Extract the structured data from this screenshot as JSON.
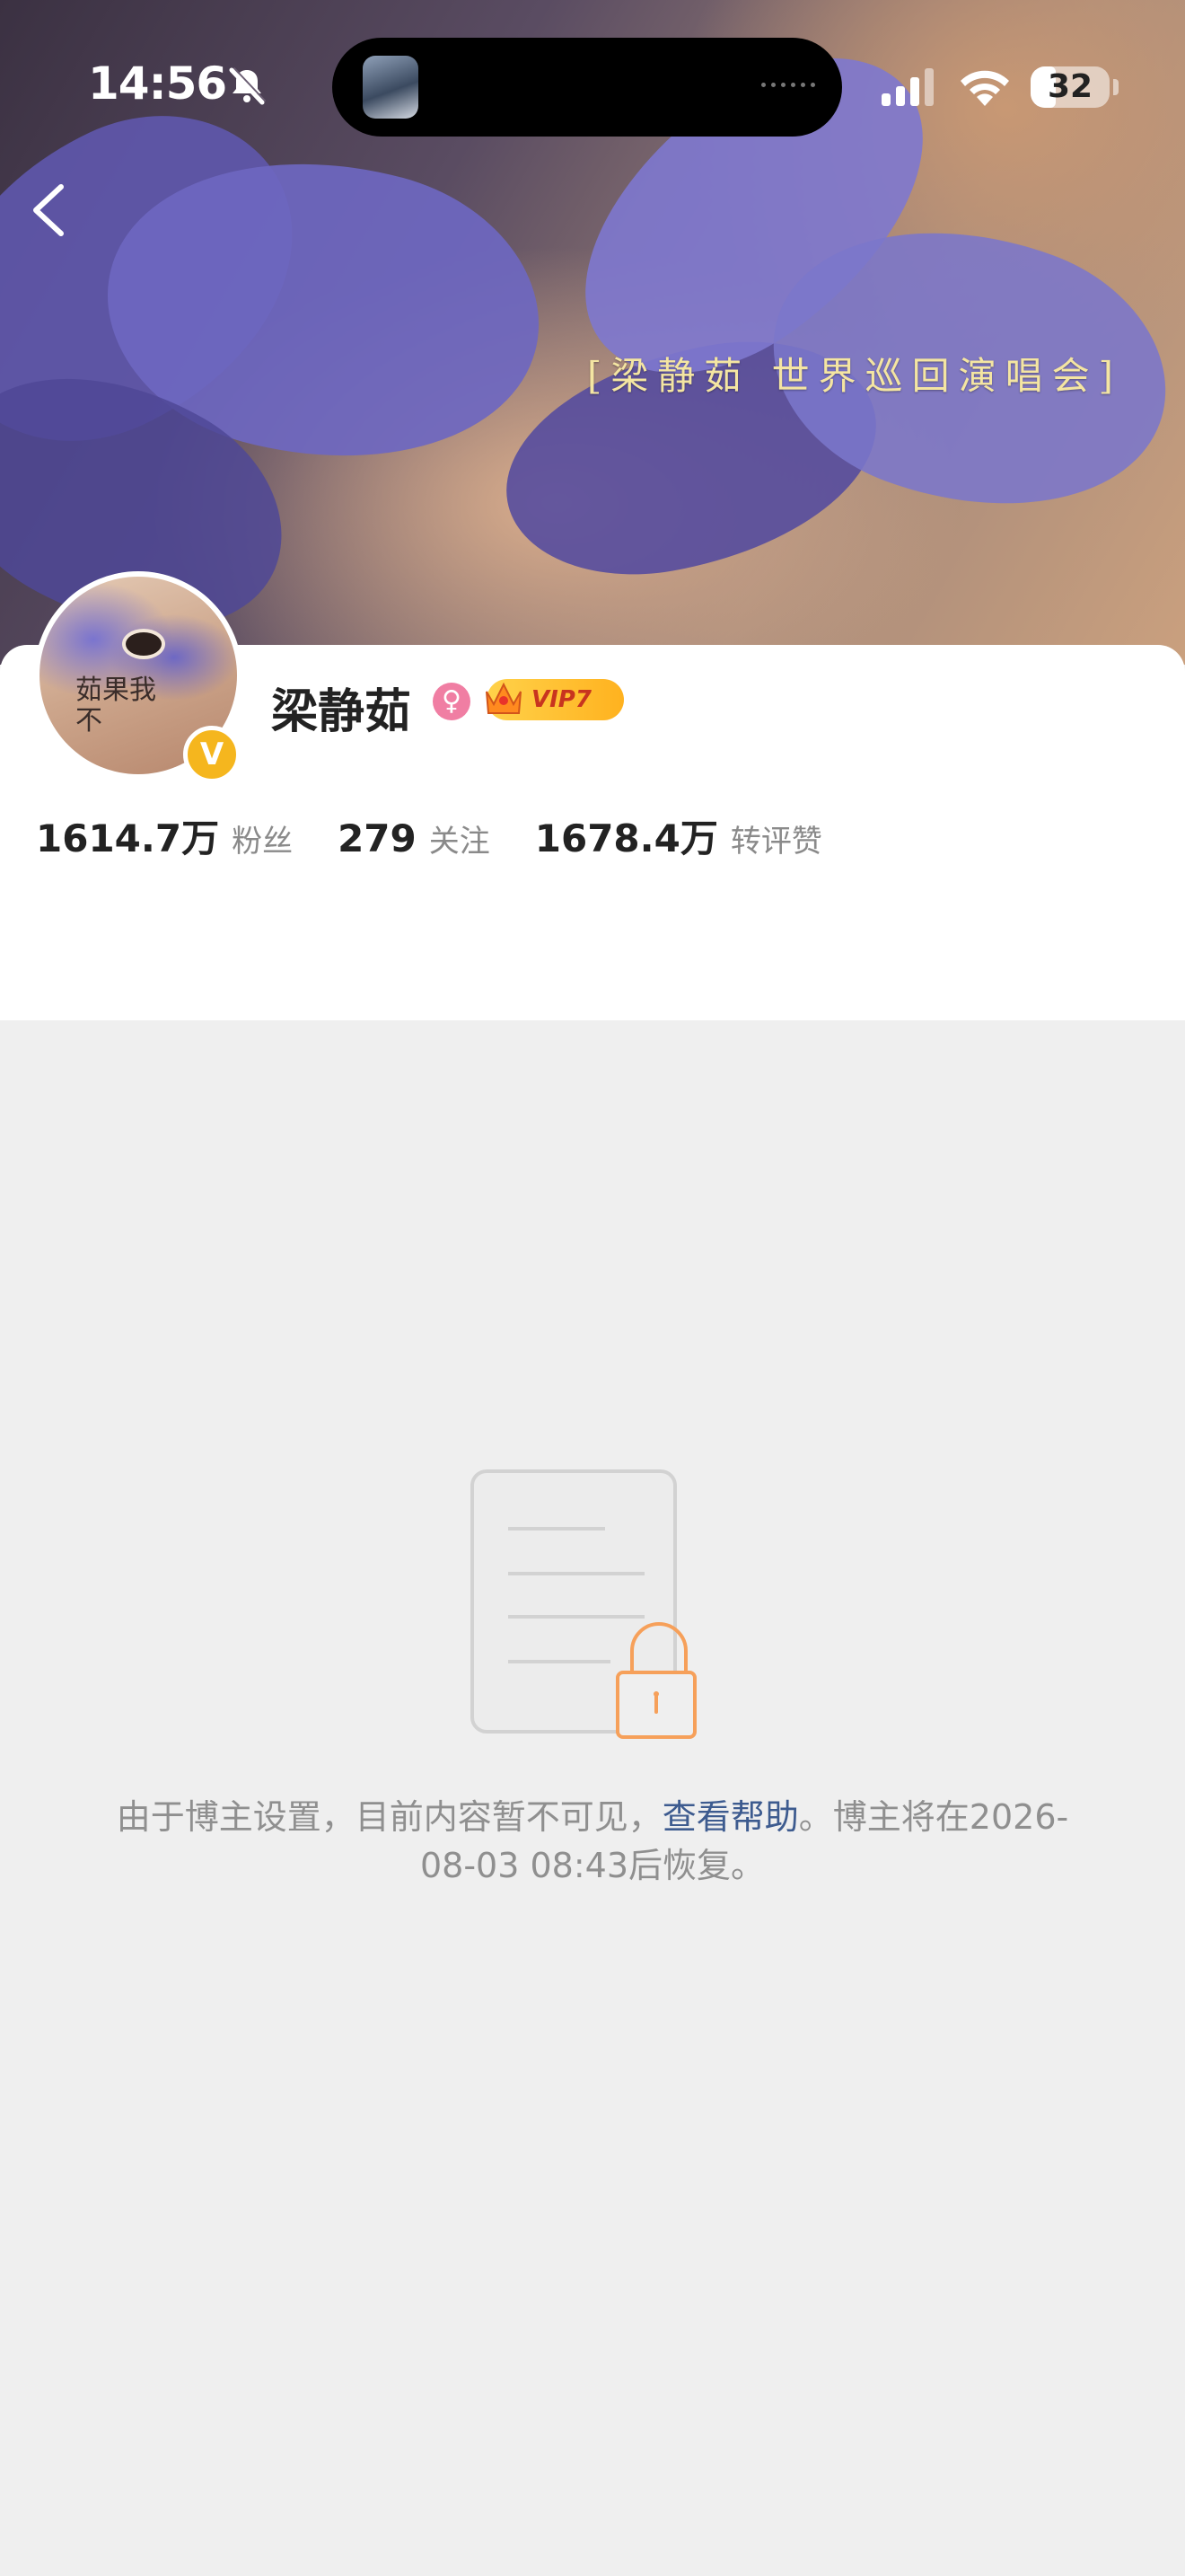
{
  "status_bar": {
    "time": "14:56",
    "battery": "32",
    "battery_level": 0.32,
    "icons": [
      "bell-slash-icon",
      "cellular-signal-icon",
      "wifi-icon",
      "battery-icon"
    ]
  },
  "banner": {
    "caption": "[梁静茹 世界巡回演唱会]"
  },
  "profile": {
    "name": "梁静茹",
    "gender": "female",
    "vip_label": "VIP7",
    "verified_badge": "V",
    "avatar_text": "茹果我不",
    "stats": [
      {
        "value": "1614.7万",
        "label": "粉丝"
      },
      {
        "value": "279",
        "label": "关注"
      },
      {
        "value": "1678.4万",
        "label": "转评赞"
      }
    ]
  },
  "empty_state": {
    "icon": "locked-document-icon",
    "text_before": "由于博主设置，目前内容暂不可见，",
    "help_link": "查看帮助",
    "text_after": "。博主将在2026-08-03 08:43后恢复。"
  },
  "colors": {
    "accent_link": "#3d5b8f",
    "verified": "#f5b61e",
    "gender_female": "#f07ea3",
    "vip": "#ffb21f",
    "lock_orange": "#f6a05a"
  }
}
